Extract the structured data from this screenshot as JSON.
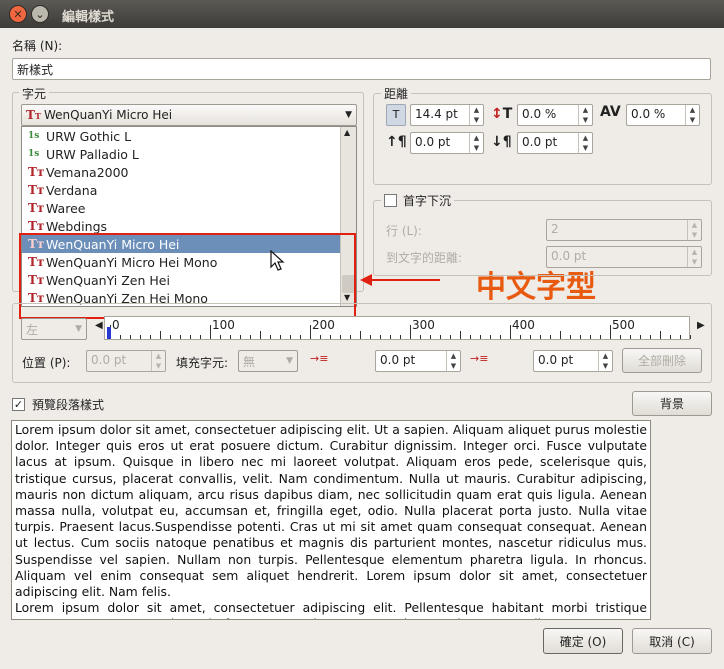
{
  "window": {
    "title": "編輯樣式"
  },
  "name": {
    "label": "名稱 (N):",
    "value": "新樣式"
  },
  "font": {
    "frame_title": "字元",
    "selected": "WenQuanYi Micro Hei",
    "items": [
      {
        "label": "URW Gothic L",
        "icon": "type1"
      },
      {
        "label": "URW Palladio L",
        "icon": "type1"
      },
      {
        "label": "Vemana2000",
        "icon": "truetype"
      },
      {
        "label": "Verdana",
        "icon": "truetype"
      },
      {
        "label": "Waree",
        "icon": "truetype"
      },
      {
        "label": "Webdings",
        "icon": "truetype"
      },
      {
        "label": "WenQuanYi Micro Hei",
        "icon": "truetype",
        "selected": true
      },
      {
        "label": "WenQuanYi Micro Hei Mono",
        "icon": "truetype"
      },
      {
        "label": "WenQuanYi Zen Hei",
        "icon": "truetype"
      },
      {
        "label": "WenQuanYi Zen Hei Mono",
        "icon": "truetype"
      }
    ]
  },
  "spacing": {
    "frame_title": "距離",
    "size": "14.4 pt",
    "scale": "0.0 %",
    "kerning": "0.0 %",
    "above": "0.0 pt",
    "below": "0.0 pt"
  },
  "dropcap": {
    "label": "首字下沉",
    "lines_label": "行 (L):",
    "lines_value": "2",
    "distance_label": "到文字的距離:",
    "distance_value": "0.0 pt"
  },
  "tabs": {
    "align": "左",
    "ruler_labels": [
      "0",
      "100",
      "200",
      "300",
      "400",
      "500"
    ],
    "position_label": "位置 (P):",
    "position_value": "0.0 pt",
    "fill_label": "填充字元:",
    "fill_value": "無",
    "first_indent": "0.0 pt",
    "left_indent": "0.0 pt",
    "delete_all": "全部刪除"
  },
  "preview": {
    "checkbox_label": "預覽段落樣式",
    "background_button": "背景",
    "text": "Lorem ipsum dolor sit amet, consectetuer adipiscing elit. Ut a sapien. Aliquam aliquet purus molestie dolor. Integer quis eros ut erat posuere dictum. Curabitur dignissim. Integer orci. Fusce vulputate lacus at ipsum. Quisque in libero nec mi laoreet volutpat. Aliquam eros pede, scelerisque quis, tristique cursus, placerat convallis, velit. Nam condimentum. Nulla ut mauris. Curabitur adipiscing, mauris non dictum aliquam, arcu risus dapibus diam, nec sollicitudin quam erat quis ligula. Aenean massa nulla, volutpat eu, accumsan et, fringilla eget, odio. Nulla placerat porta justo. Nulla vitae turpis. Praesent lacus.Suspendisse potenti. Cras ut mi sit amet quam consequat consequat. Aenean ut lectus. Cum sociis natoque penatibus et magnis dis parturient montes, nascetur ridiculus mus. Suspendisse vel sapien. Nullam non turpis. Pellentesque elementum pharetra ligula. In rhoncus. Aliquam vel enim consequat sem aliquet hendrerit. Lorem ipsum dolor sit amet, consectetuer adipiscing elit. Nam felis.",
    "text2": "Lorem ipsum dolor sit amet, consectetuer adipiscing elit. Pellentesque habitant morbi tristique senectus et netus et malesuada fames ac turpis egestas. Quisque vel erat eget diam consectetuer iaculis. Cras ante velit, suscipit et, porta tempus, dignissim quis, magna. Vivamus viverra, turpis nec rhoncus ultricies, diam turpis eleifend nisl, a eleifend ante felis ac sapien. Integer bibendum. Suspendisse in mi non neque bibendum convallis. Suspendisse potenti. Sed sit"
  },
  "buttons": {
    "ok": "確定 (O)",
    "cancel": "取消 (C)"
  },
  "annotation": {
    "text": "中文字型",
    "color": "#e85a10"
  },
  "colors": {
    "selection": "#6b8fb9",
    "highlight_box": "#e02010"
  }
}
